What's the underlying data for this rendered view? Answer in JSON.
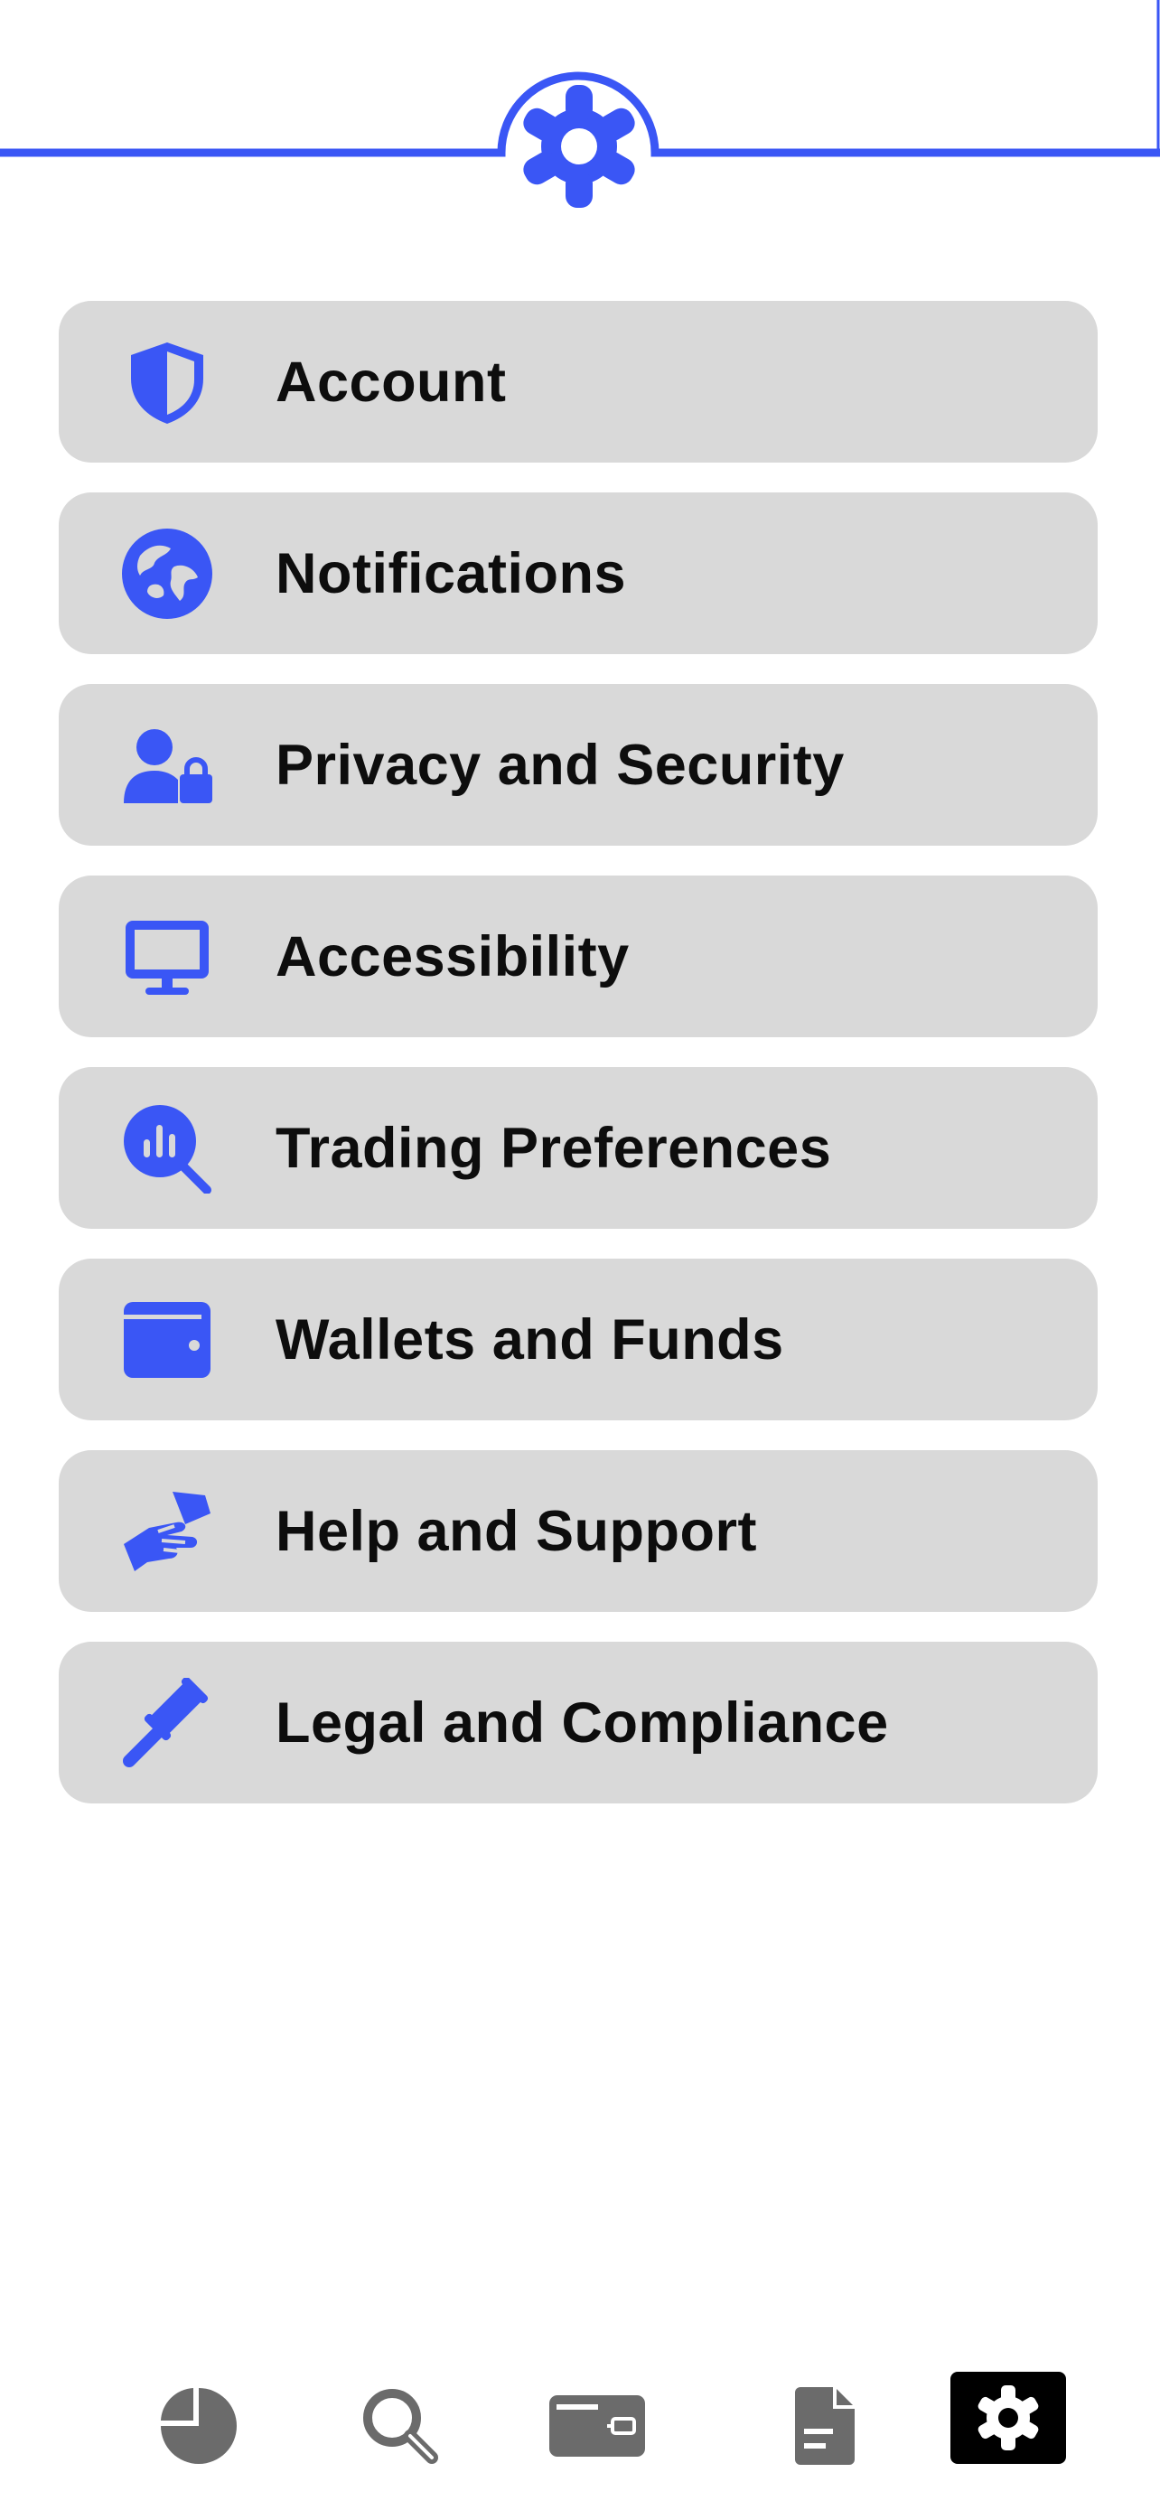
{
  "colors": {
    "accent": "#3a56f5",
    "item_bg": "#d9d9d9",
    "tab_inactive": "#6b6b6b",
    "tab_active_bg": "#000000"
  },
  "header": {
    "icon": "gear-icon"
  },
  "menu": {
    "items": [
      {
        "label": "Account",
        "icon": "shield-icon"
      },
      {
        "label": "Notifications",
        "icon": "globe-icon"
      },
      {
        "label": "Privacy and Security",
        "icon": "user-lock-icon"
      },
      {
        "label": "Accessibility",
        "icon": "monitor-icon"
      },
      {
        "label": "Trading Preferences",
        "icon": "chart-search-icon"
      },
      {
        "label": "Wallets and Funds",
        "icon": "wallet-icon"
      },
      {
        "label": "Help and Support",
        "icon": "handshake-icon"
      },
      {
        "label": "Legal and Compliance",
        "icon": "gavel-icon"
      }
    ]
  },
  "tabbar": {
    "tabs": [
      {
        "icon": "pie-chart-icon",
        "active": false
      },
      {
        "icon": "search-icon",
        "active": false
      },
      {
        "icon": "wallet-icon",
        "active": false
      },
      {
        "icon": "document-icon",
        "active": false
      },
      {
        "icon": "gear-icon",
        "active": true
      }
    ]
  }
}
